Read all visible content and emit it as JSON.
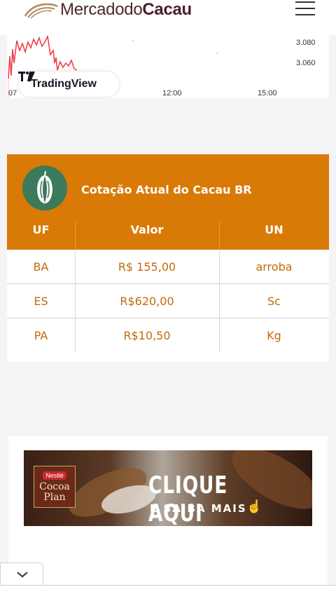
{
  "header": {
    "brand_part1": "Mercadodo",
    "brand_part2": "Cacau",
    "menu_icon": "hamburger-icon"
  },
  "tradingview_chart": {
    "y_tick_labels": [
      "3.080",
      "3.060"
    ],
    "x_tick_labels": [
      "07",
      "12:00",
      "15:00"
    ],
    "badge_label": "TradingView",
    "line_color": "#f23645"
  },
  "price_table": {
    "title": "Cotação Atual do Cacau BR",
    "header_color": "#d97a06",
    "columns": [
      "UF",
      "Valor",
      "UN"
    ],
    "rows": [
      {
        "uf": "BA",
        "valor": "R$ 155,00",
        "un": "arroba"
      },
      {
        "uf": "ES",
        "valor": "R$620,00",
        "un": "Sc"
      },
      {
        "uf": "PA",
        "valor": "R$10,50",
        "un": "Kg"
      }
    ],
    "icon": "cacao-pod-icon"
  },
  "banner": {
    "brand_badge": "Nestlé",
    "brand_line1": "Cocoa",
    "brand_line2": "Plan",
    "cta_main": "CLIQUE AQUI",
    "cta_sub": "E SAIBA MAIS"
  },
  "bottom": {
    "collapse_icon": "chevron-down-icon"
  }
}
